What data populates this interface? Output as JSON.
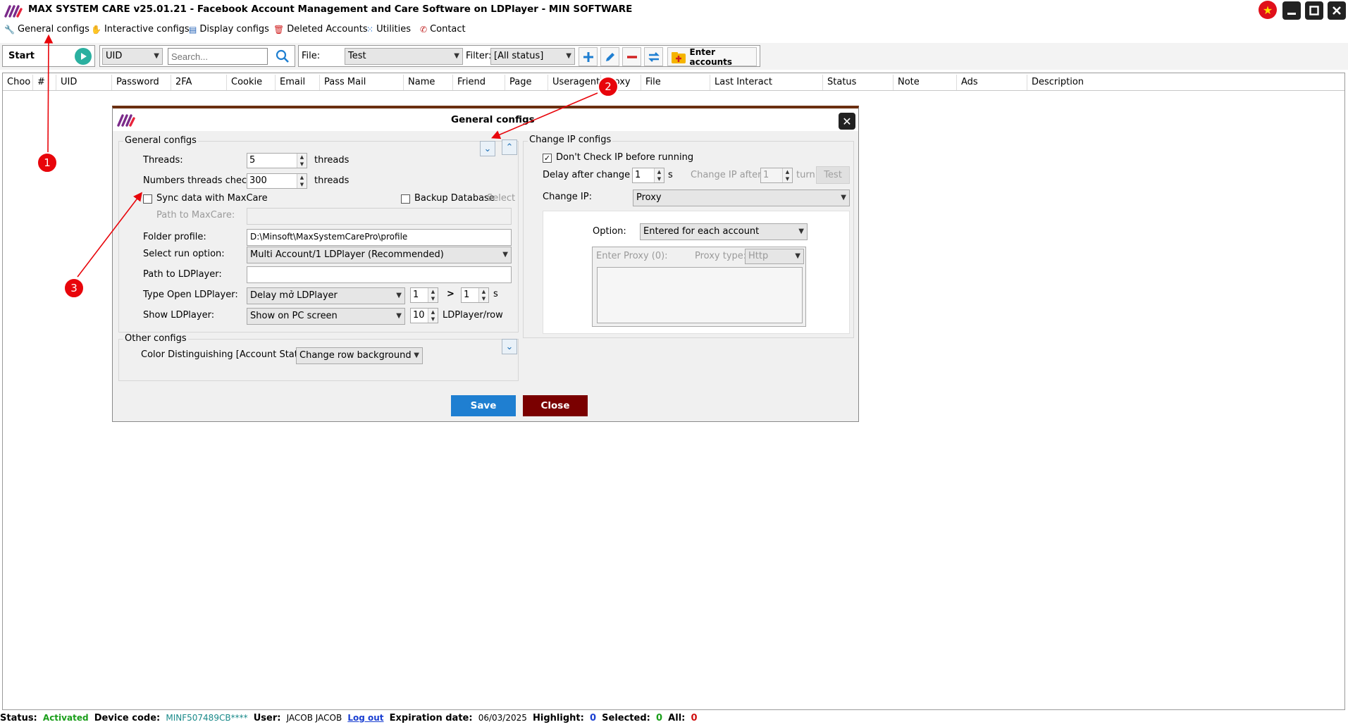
{
  "app": {
    "title": "MAX SYSTEM CARE v25.01.21 - Facebook Account Management and Care Software on LDPlayer - MIN SOFTWARE"
  },
  "menu": {
    "items": [
      {
        "label": "General configs",
        "icon": "wrench-icon"
      },
      {
        "label": "Interactive configs",
        "icon": "hand-icon"
      },
      {
        "label": "Display configs",
        "icon": "display-icon"
      },
      {
        "label": "Deleted Accounts",
        "icon": "trash-icon"
      },
      {
        "label": "Utilities",
        "icon": "grid-icon"
      },
      {
        "label": "Contact",
        "icon": "contact-icon"
      }
    ]
  },
  "toolbar": {
    "start_label": "Start",
    "search_field": "UID",
    "search_placeholder": "Search...",
    "file_label": "File:",
    "file_value": "Test",
    "filter_label": "Filter:",
    "filter_value": "[All status]",
    "enter_accounts_label": "Enter accounts"
  },
  "grid": {
    "columns": [
      "Choo",
      "#",
      "UID",
      "Password",
      "2FA",
      "Cookie",
      "Email",
      "Pass Mail",
      "Name",
      "Friend",
      "Page",
      "Useragent",
      "Proxy",
      "File",
      "Last Interact",
      "Status",
      "Note",
      "Ads",
      "Description"
    ]
  },
  "dialog": {
    "title": "General configs",
    "general": {
      "group_title": "General configs",
      "threads_label": "Threads:",
      "threads_value": "5",
      "threads_unit": "threads",
      "check_label": "Numbers threads check in",
      "check_value": "300",
      "check_unit": "threads",
      "sync_label": "Sync data with MaxCare",
      "sync_checked": false,
      "backup_label": "Backup Database",
      "backup_checked": false,
      "select_label": "Select",
      "path_maxcare_label": "Path to MaxCare:",
      "path_maxcare_value": "",
      "folder_profile_label": "Folder profile:",
      "folder_profile_value": "D:\\Minsoft\\MaxSystemCarePro\\profile",
      "run_option_label": "Select run option:",
      "run_option_value": "Multi Account/1 LDPlayer (Recommended)",
      "path_ld_label": "Path to LDPlayer:",
      "path_ld_value": "",
      "type_open_label": "Type Open LDPlayer:",
      "type_open_value": "Delay mở LDPlayer",
      "delay_from": "1",
      "delay_sep": ">",
      "delay_to": "1",
      "delay_unit": "s",
      "show_label": "Show LDPlayer:",
      "show_value": "Show on PC screen",
      "per_row_value": "10",
      "per_row_unit": "LDPlayer/row"
    },
    "other": {
      "group_title": "Other configs",
      "color_label": "Color Distinguishing [Account Status]:",
      "color_value": "Change row background"
    },
    "change_ip": {
      "group_title": "Change IP configs",
      "dont_check_label": "Don't Check IP before running",
      "dont_check_checked": true,
      "delay_label": "Delay after change IP:",
      "delay_value": "1",
      "delay_unit": "s",
      "after_label": "Change IP after:",
      "after_value": "1",
      "after_unit": "turn",
      "test_label": "Test",
      "method_label": "Change IP:",
      "method_value": "Proxy",
      "option_label": "Option:",
      "option_value": "Entered for each account",
      "enter_proxy_label": "Enter Proxy (0):",
      "proxy_type_label": "Proxy type:",
      "proxy_type_value": "Http"
    },
    "save_label": "Save",
    "close_label": "Close"
  },
  "annotations": [
    "1",
    "2",
    "3"
  ],
  "statusbar": {
    "status_label": "Status:",
    "status_value": "Activated",
    "device_label": "Device code:",
    "device_value": "MINF507489CB****",
    "user_label": "User:",
    "user_value": "JACOB JACOB",
    "logout_label": "Log out",
    "expiration_label": "Expiration date:",
    "expiration_value": "06/03/2025",
    "highlight_label": "Highlight:",
    "highlight_value": "0",
    "selected_label": "Selected:",
    "selected_value": "0",
    "all_label": "All:",
    "all_value": "0"
  },
  "colors": {
    "accent_blue": "#1f7fd1",
    "dialog_border": "#6b2f10",
    "save_button": "#1f7fd1",
    "close_button": "#7a0000",
    "status_green": "#1a9e1a",
    "annotation_red": "#e8050b"
  }
}
